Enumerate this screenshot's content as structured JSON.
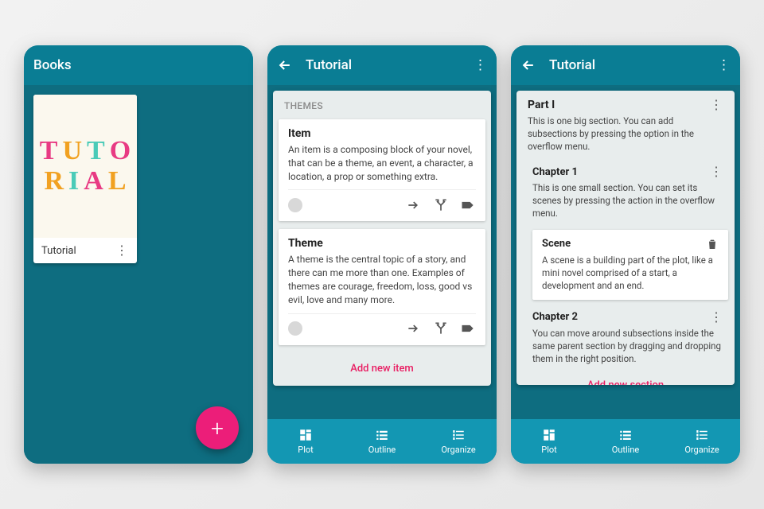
{
  "colors": {
    "primary": "#0a7d94",
    "primaryDark": "#0e6d80",
    "accent": "#ec1e79",
    "link": "#e91e63",
    "navBar": "#1397b3"
  },
  "screen1": {
    "title": "Books",
    "book": {
      "label": "Tutorial"
    },
    "cover_letters": [
      "T",
      "U",
      "T",
      "O",
      "R",
      "I",
      "A",
      "L"
    ]
  },
  "screen2": {
    "title": "Tutorial",
    "panel_label": "THEMES",
    "cards": [
      {
        "title": "Item",
        "body": "An item is a composing block of your novel, that can be a theme, an event, a character, a location, a prop or something extra."
      },
      {
        "title": "Theme",
        "body": "A theme is the central topic of a story, and there can me more than one. Examples of themes are courage, freedom, loss, good vs evil, love and many more."
      }
    ],
    "add_label": "Add new item"
  },
  "screen3": {
    "title": "Tutorial",
    "part": {
      "title": "Part I",
      "desc": "This is one big section. You can add subsections by pressing the option in the overflow menu."
    },
    "ch1": {
      "title": "Chapter 1",
      "desc": "This is one small section. You can set its scenes by pressing the action in the overflow menu."
    },
    "scene": {
      "title": "Scene",
      "desc": "A scene is a building part of the plot, like a mini novel comprised of a start, a development and an end."
    },
    "ch2": {
      "title": "Chapter 2",
      "desc": "You can move around subsections inside the same parent section by dragging and dropping them in the right position."
    },
    "add_label": "Add new section"
  },
  "bottomnav": {
    "items": [
      {
        "label": "Plot"
      },
      {
        "label": "Outline"
      },
      {
        "label": "Organize"
      }
    ]
  }
}
